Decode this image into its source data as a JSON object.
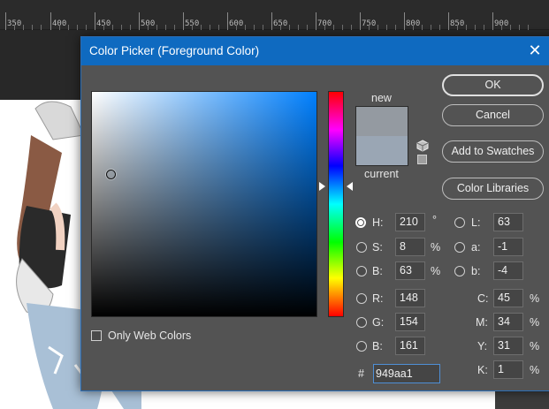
{
  "ruler": {
    "labels": [
      "350",
      "400",
      "450",
      "500",
      "550",
      "600",
      "650",
      "700",
      "750",
      "800",
      "850",
      "900"
    ]
  },
  "dialog": {
    "title": "Color Picker (Foreground Color)",
    "close_glyph": "✕",
    "new_label": "new",
    "current_label": "current",
    "new_color": "#949aa1",
    "current_color": "#9aa6b4",
    "buttons": {
      "ok": "OK",
      "cancel": "Cancel",
      "add_swatches": "Add to Swatches",
      "libraries": "Color Libraries"
    },
    "only_web_colors": "Only Web Colors",
    "hsb": {
      "h": {
        "label": "H:",
        "value": "210",
        "unit": "°"
      },
      "s": {
        "label": "S:",
        "value": "8",
        "unit": "%"
      },
      "b": {
        "label": "B:",
        "value": "63",
        "unit": "%"
      }
    },
    "rgb": {
      "r": {
        "label": "R:",
        "value": "148"
      },
      "g": {
        "label": "G:",
        "value": "154"
      },
      "b": {
        "label": "B:",
        "value": "161"
      }
    },
    "lab": {
      "l": {
        "label": "L:",
        "value": "63"
      },
      "a": {
        "label": "a:",
        "value": "-1"
      },
      "b": {
        "label": "b:",
        "value": "-4"
      }
    },
    "cmyk": {
      "c": {
        "label": "C:",
        "value": "45",
        "unit": "%"
      },
      "m": {
        "label": "M:",
        "value": "34",
        "unit": "%"
      },
      "y": {
        "label": "Y:",
        "value": "31",
        "unit": "%"
      },
      "k": {
        "label": "K:",
        "value": "1",
        "unit": "%"
      }
    },
    "hex": {
      "prefix": "#",
      "value": "949aa1"
    }
  }
}
